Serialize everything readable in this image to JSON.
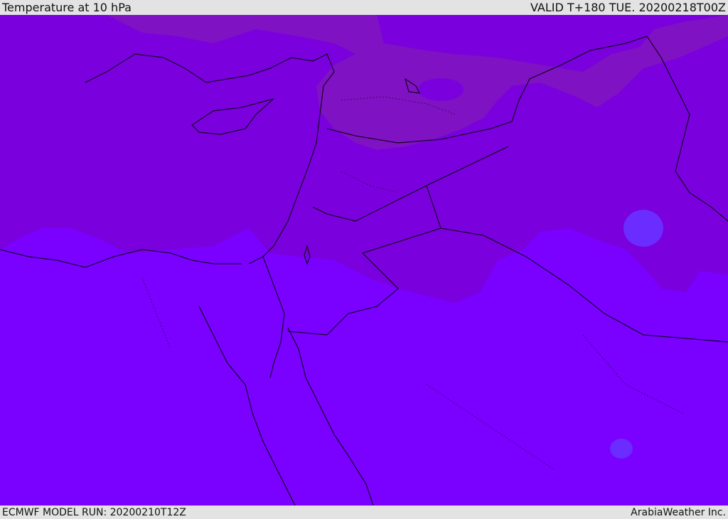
{
  "header": {
    "title": "Temperature at 10 hPa",
    "valid": "VALID T+180 TUE. 20200218T00Z"
  },
  "footer": {
    "model_run": "ECMWF MODEL RUN: 20200210T12Z",
    "credit": "ArabiaWeather Inc."
  },
  "colors": {
    "background_band": "#e3e3e3",
    "field_south": "#7a00ff",
    "field_north": "#7a00dd",
    "field_northeast": "#7f14c0",
    "field_pocket_blue": "#6a2cff",
    "coastline": "#000000"
  }
}
